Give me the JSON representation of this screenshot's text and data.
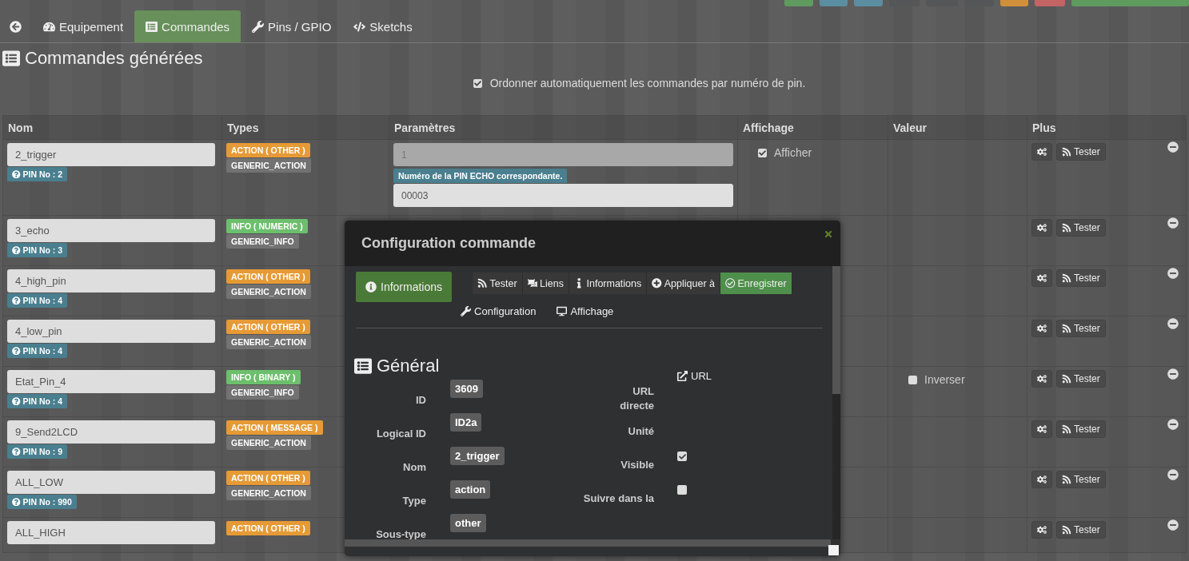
{
  "top_buttons": [
    {
      "color": "#5f9a5f"
    },
    {
      "color": "#5a8ea0"
    },
    {
      "color": "#5a8ea0"
    },
    {
      "color": "#555658"
    },
    {
      "color": "#555658"
    },
    {
      "color": "#555658"
    },
    {
      "color": "#d08f3b"
    },
    {
      "color": "#c46464"
    },
    {
      "color": "#5f9a5f"
    }
  ],
  "tabs": [
    {
      "kind": "back",
      "selected": false
    },
    {
      "kind": "tab",
      "label": "Equipement",
      "selected": false
    },
    {
      "kind": "tab",
      "label": "Commandes",
      "selected": true
    },
    {
      "kind": "tab",
      "label": "Pins / GPIO",
      "selected": false
    },
    {
      "kind": "tab",
      "label": "Sketchs",
      "selected": false
    }
  ],
  "section_title": "Commandes générées",
  "auto_sort": {
    "label": "Ordonner automatiquement les commandes par numéro de pin.",
    "checked": true
  },
  "table": {
    "columns": [
      "Nom",
      "Types",
      "Paramètres",
      "Affichage",
      "Valeur",
      "Plus"
    ],
    "rows": [
      {
        "name": "2_trigger",
        "pin": "PIN No : 2",
        "type": {
          "kind": "action",
          "label": "ACTION ( OTHER )"
        },
        "generic": "GENERIC_ACTION",
        "params": {
          "value": "1",
          "help": "Numéro de la PIN ECHO correspondante.",
          "second_value": "00003"
        },
        "display": {
          "label": "Afficher",
          "checked": true
        },
        "test": "Tester"
      },
      {
        "name": "3_echo",
        "pin": "PIN No : 3",
        "type": {
          "kind": "info",
          "label": "INFO ( NUMERIC )"
        },
        "generic": "GENERIC_INFO",
        "test": "Tester"
      },
      {
        "name": "4_high_pin",
        "pin": "PIN No : 4",
        "type": {
          "kind": "action",
          "label": "ACTION ( OTHER )"
        },
        "generic": "GENERIC_ACTION",
        "test": "Tester"
      },
      {
        "name": "4_low_pin",
        "pin": "PIN No : 4",
        "type": {
          "kind": "action",
          "label": "ACTION ( OTHER )"
        },
        "generic": "GENERIC_ACTION",
        "test": "Tester"
      },
      {
        "name": "Etat_Pin_4",
        "pin": "PIN No : 4",
        "type": {
          "kind": "info",
          "label": "INFO ( BINARY )"
        },
        "generic": "GENERIC_INFO",
        "value": {
          "label": "Inverser",
          "checked": false
        },
        "test": "Tester"
      },
      {
        "name": "9_Send2LCD",
        "pin": "PIN No : 9",
        "type": {
          "kind": "action",
          "label": "ACTION ( MESSAGE )"
        },
        "generic": "GENERIC_ACTION",
        "test": "Tester"
      },
      {
        "name": "ALL_LOW",
        "pin": "PIN No : 990",
        "type": {
          "kind": "action",
          "label": "ACTION ( OTHER )"
        },
        "generic": "GENERIC_ACTION",
        "test": "Tester"
      },
      {
        "name": "ALL_HIGH",
        "type": {
          "kind": "action",
          "label": "ACTION ( OTHER )"
        },
        "test": "Tester"
      }
    ]
  },
  "modal": {
    "title": "Configuration commande",
    "side_tab": {
      "label": "Informations",
      "selected": true
    },
    "actions": [
      {
        "kind": "default",
        "label": "Tester"
      },
      {
        "kind": "default",
        "label": "Liens"
      },
      {
        "kind": "default",
        "label": "Informations"
      },
      {
        "kind": "default",
        "label": "Appliquer à"
      },
      {
        "kind": "success",
        "label": "Enregistrer"
      }
    ],
    "tabs": [
      {
        "label": "Configuration",
        "selected": false
      },
      {
        "label": "Affichage",
        "selected": false
      }
    ],
    "section": "Général",
    "left_fields": [
      {
        "label": "ID",
        "value": "3609"
      },
      {
        "label": "Logical ID",
        "value": "ID2a"
      },
      {
        "label": "Nom",
        "value": "2_trigger"
      },
      {
        "label": "Type",
        "value": "action"
      },
      {
        "label": "Sous-type",
        "value": "other"
      }
    ],
    "right_fields": [
      {
        "kind": "link",
        "label": "URL directe",
        "value": "URL"
      },
      {
        "kind": "text",
        "label": "Unité"
      },
      {
        "kind": "checkbox",
        "label": "Visible",
        "checked": true
      },
      {
        "kind": "checkbox",
        "label": "Suivre dans la",
        "checked": false
      }
    ]
  }
}
